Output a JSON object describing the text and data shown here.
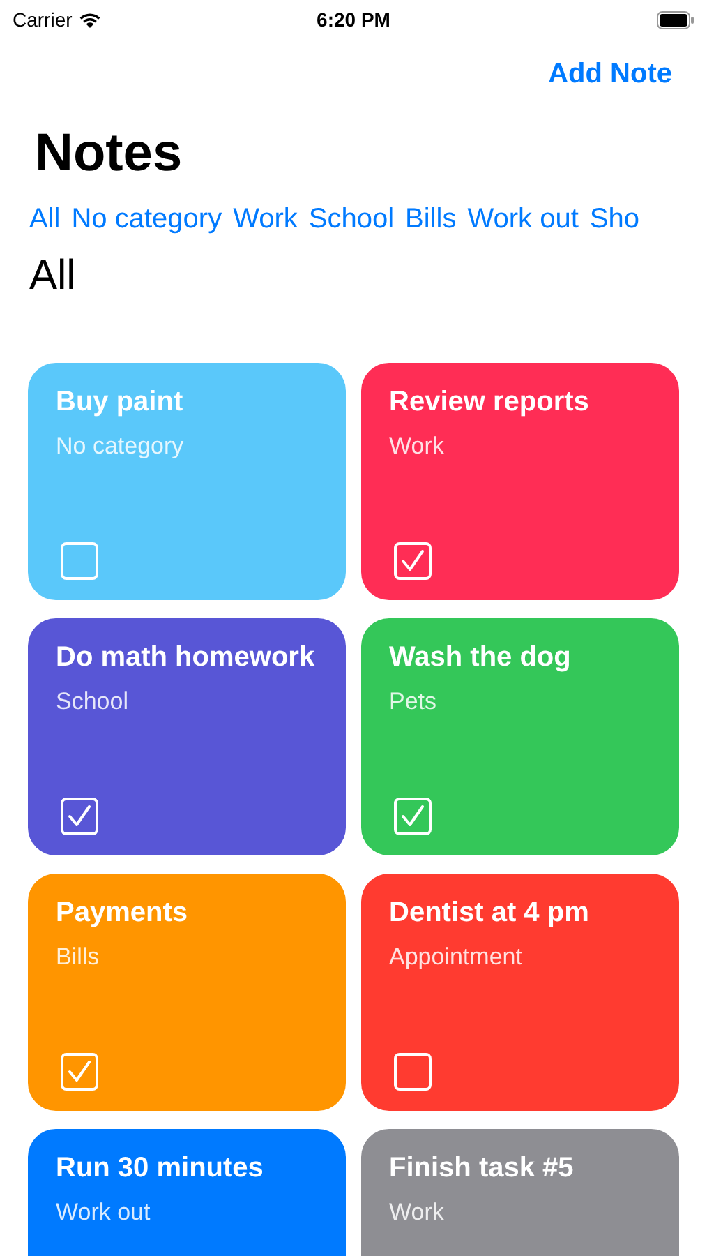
{
  "status_bar": {
    "carrier": "Carrier",
    "time": "6:20 PM"
  },
  "nav": {
    "action": "Add Note",
    "title": "Notes"
  },
  "categories": [
    "All",
    "No category",
    "Work",
    "School",
    "Bills",
    "Work out",
    "Sho"
  ],
  "current_filter": "All",
  "notes": [
    {
      "title": "Buy paint",
      "category": "No category",
      "color": "#5ac8fa",
      "checked": false
    },
    {
      "title": "Review reports",
      "category": "Work",
      "color": "#ff2d55",
      "checked": true
    },
    {
      "title": "Do math homework",
      "category": "School",
      "color": "#5856d6",
      "checked": true
    },
    {
      "title": "Wash the dog",
      "category": "Pets",
      "color": "#34c759",
      "checked": true
    },
    {
      "title": "Payments",
      "category": "Bills",
      "color": "#ff9500",
      "checked": true
    },
    {
      "title": "Dentist at 4 pm",
      "category": "Appointment",
      "color": "#ff3b30",
      "checked": false
    },
    {
      "title": "Run 30 minutes",
      "category": "Work out",
      "color": "#007aff"
    },
    {
      "title": "Finish task #5",
      "category": "Work",
      "color": "#8e8e93"
    }
  ]
}
